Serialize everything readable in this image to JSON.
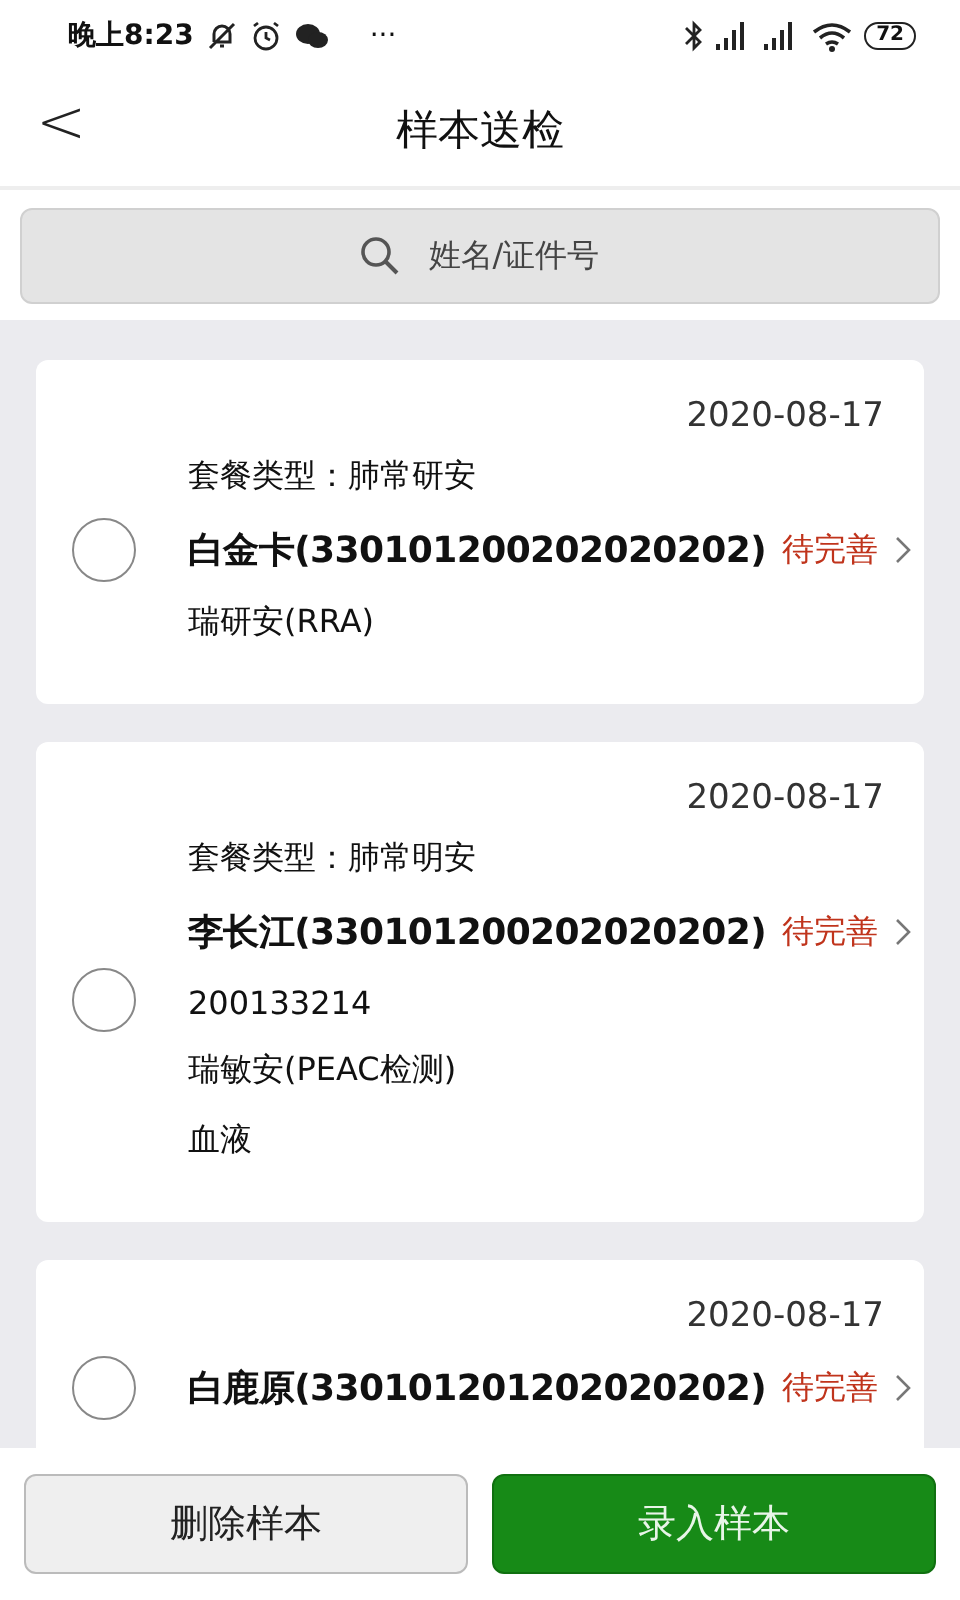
{
  "status_bar": {
    "time": "晚上8:23",
    "more": "···",
    "battery": "72"
  },
  "header": {
    "back": "<",
    "title": "样本送检"
  },
  "search": {
    "placeholder": "姓名/证件号"
  },
  "samples": [
    {
      "selected": false,
      "date": "2020-08-17",
      "package": "套餐类型：肺常研安",
      "name": "白金卡(330101200202020202)",
      "status": "待完善",
      "details": [
        "瑞研安(RRA)"
      ]
    },
    {
      "selected": false,
      "date": "2020-08-17",
      "package": "套餐类型：肺常明安",
      "name": "李长江(330101200202020202)",
      "status": "待完善",
      "details": [
        "200133214",
        "瑞敏安(PEAC检测)",
        "血液"
      ]
    },
    {
      "selected": false,
      "date": "2020-08-17",
      "name": "白鹿原(330101201202020202)",
      "status": "待完善"
    }
  ],
  "buttons": [
    {
      "label": "删除样本",
      "kind": "secondary"
    },
    {
      "label": "录入样本",
      "kind": "primary"
    }
  ]
}
